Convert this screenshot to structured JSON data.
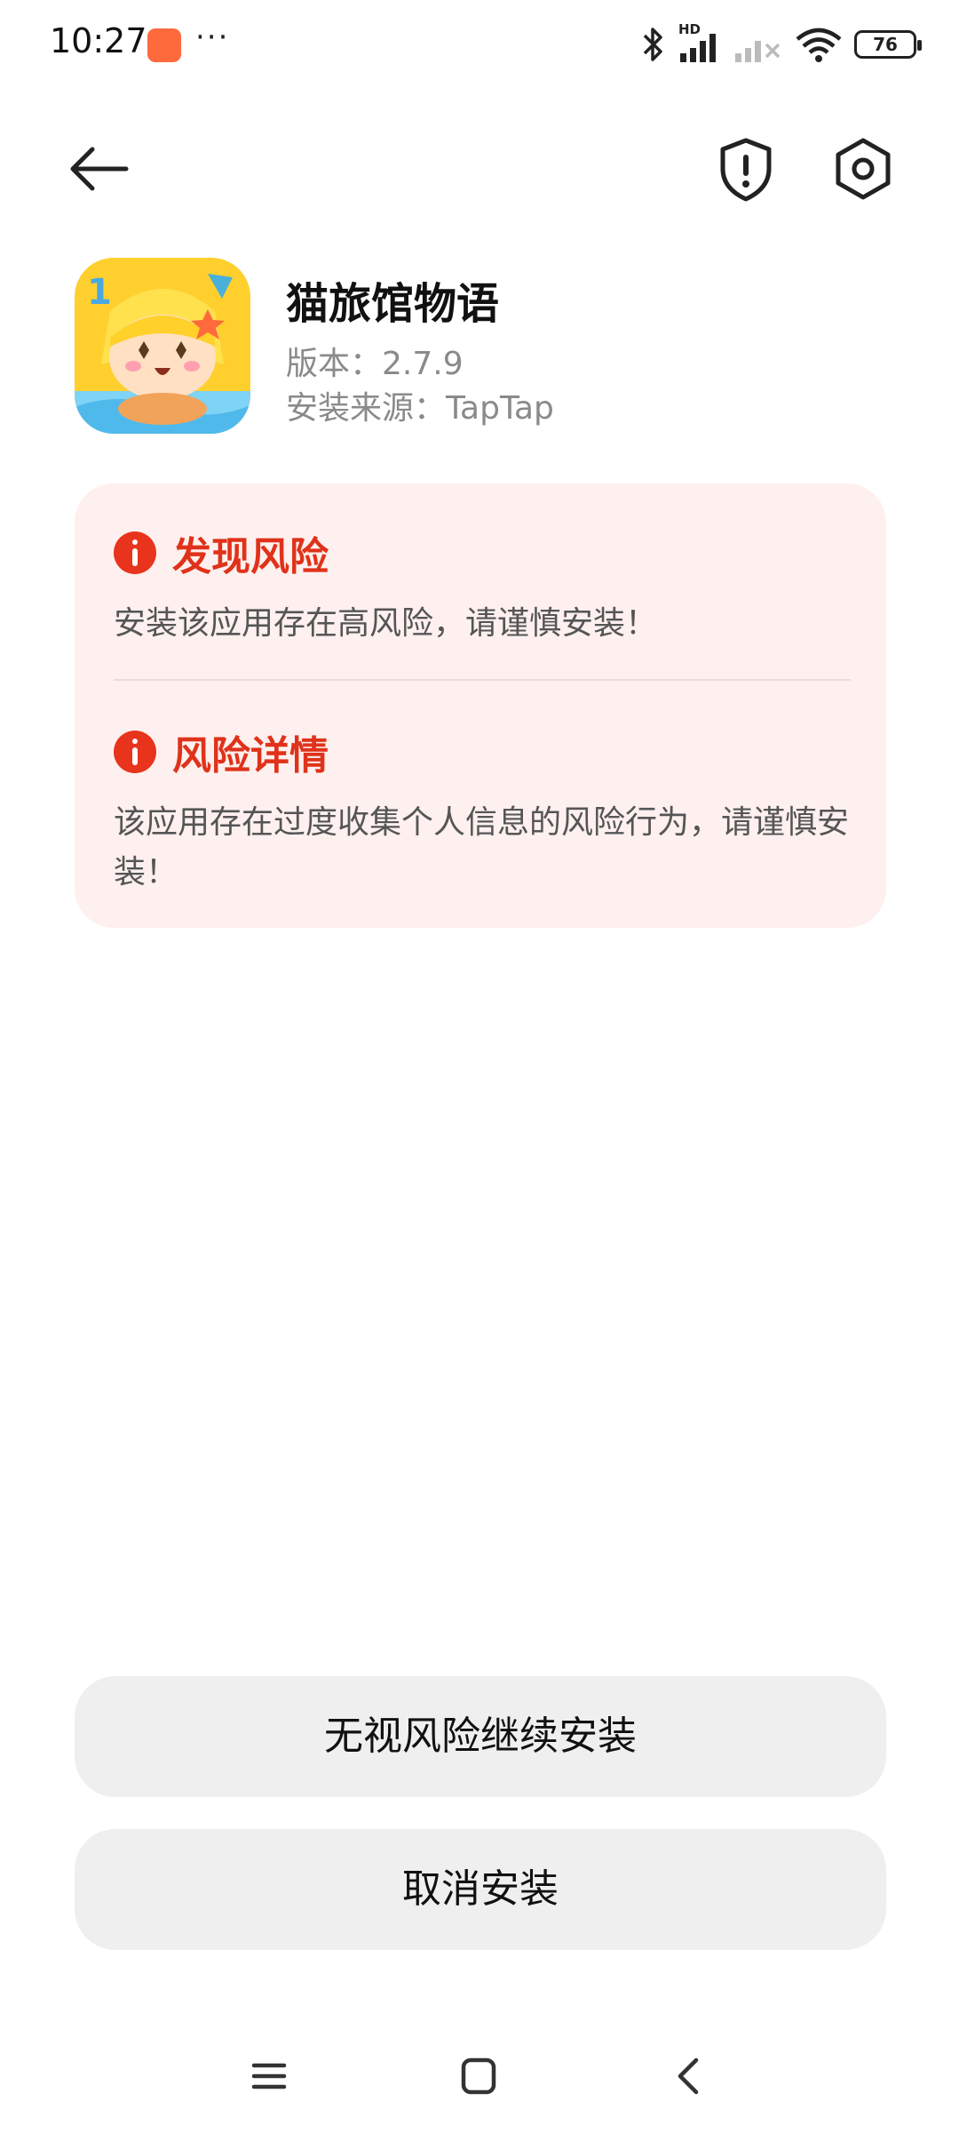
{
  "status_bar": {
    "time": "10:27",
    "dots": "···",
    "signal_label": "HD",
    "battery": "76",
    "icons": [
      "bluetooth-icon",
      "signal-hd-icon",
      "signal-off-icon",
      "wifi-icon",
      "battery-icon"
    ]
  },
  "top_bar": {
    "icons": [
      "back-arrow-icon",
      "shield-exclamation-icon",
      "settings-gear-icon"
    ]
  },
  "app": {
    "name": "猫旅馆物语",
    "version": "版本：2.7.9",
    "source": "安装来源：TapTap"
  },
  "risk": {
    "found_title": "发现风险",
    "found_desc": "安装该应用存在高风险，请谨慎安装！",
    "detail_title": "风险详情",
    "detail_desc": "该应用存在过度收集个人信息的风险行为，请谨慎安装！",
    "accent_color": "#e0321a",
    "card_color": "#fdf0ee"
  },
  "buttons": {
    "continue_label": "无视风险继续安装",
    "cancel_label": "取消安装"
  },
  "nav_bar": {
    "icons": [
      "menu-lines-icon",
      "home-square-icon",
      "back-chevron-icon"
    ]
  }
}
